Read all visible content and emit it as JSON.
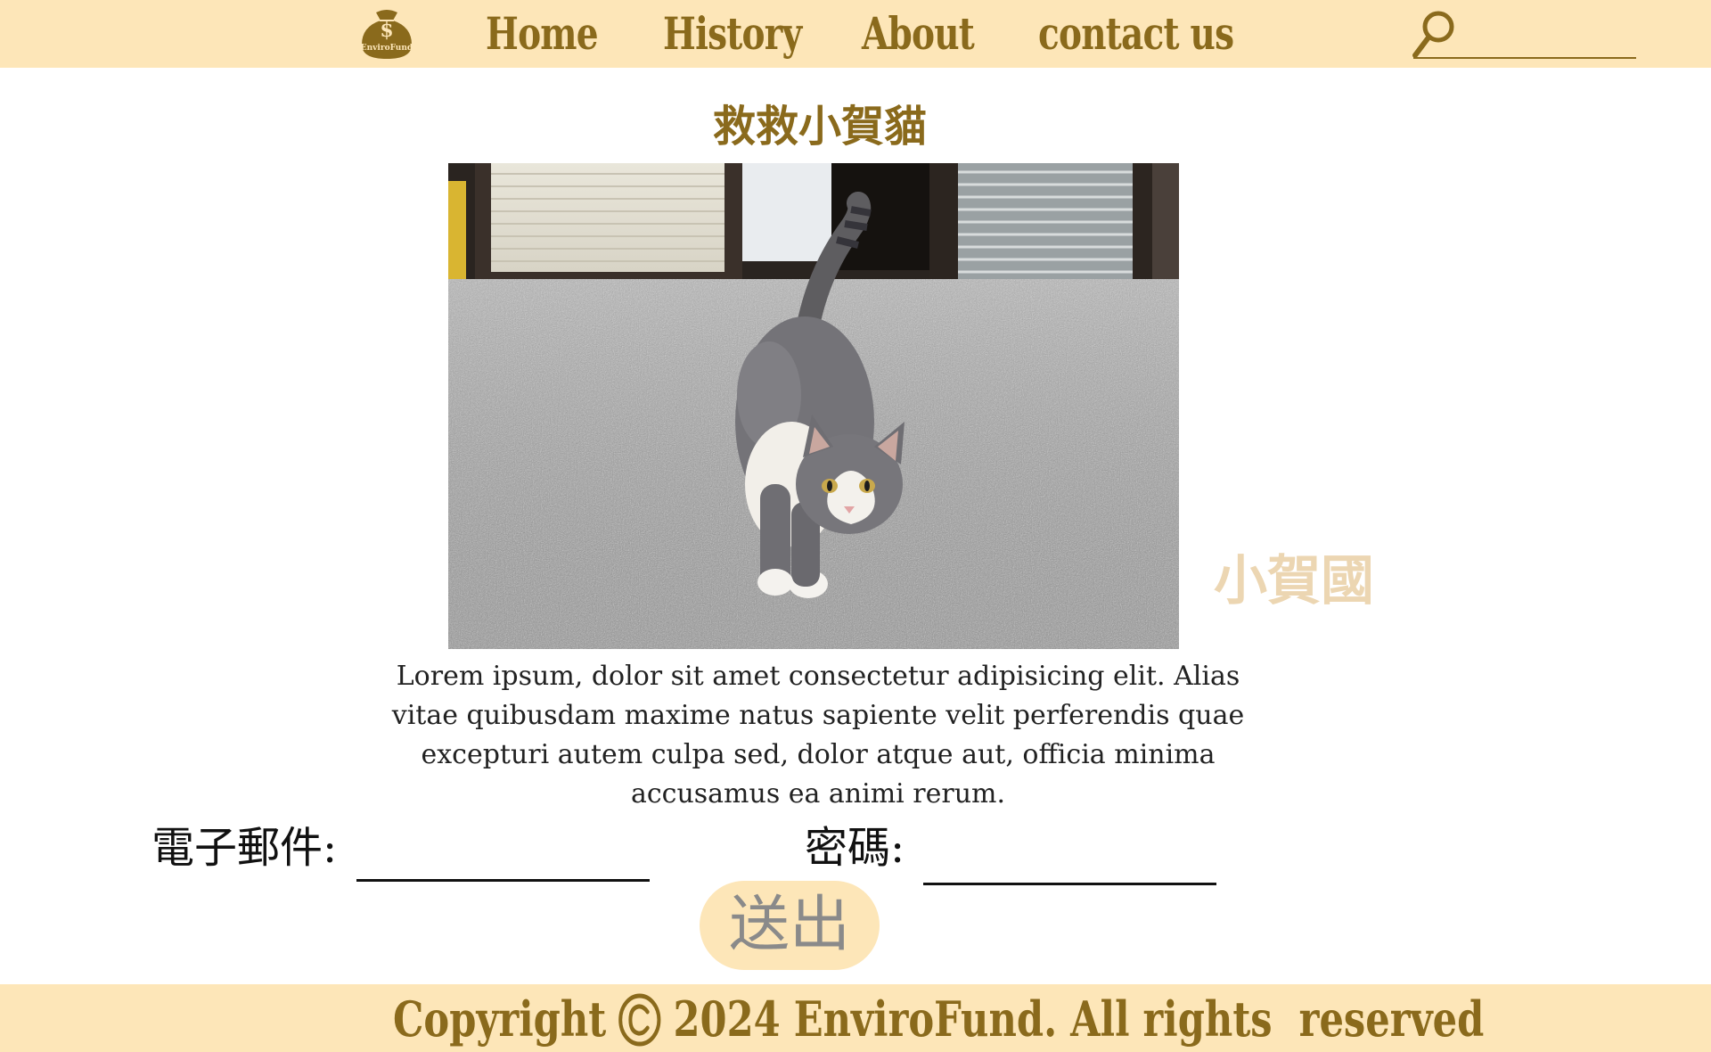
{
  "header": {
    "logo_text": "EnviroFund",
    "logo_symbol": "$",
    "nav": [
      {
        "label": "Home"
      },
      {
        "label": "History"
      },
      {
        "label": "About"
      },
      {
        "label": "contact us"
      }
    ],
    "search": {
      "icon": "search-icon",
      "value": ""
    }
  },
  "main": {
    "title": "救救小賀貓",
    "photo": {
      "subject": "cat-photo"
    },
    "side_label": "小賀國",
    "body_text": "Lorem ipsum, dolor sit amet consectetur adipisicing elit. Alias vitae quibusdam maxime natus sapiente velit perferendis quae excepturi autem culpa sed, dolor atque aut, officia minima accusamus ea animi rerum.",
    "form": {
      "email_label": "電子郵件:",
      "email_value": "",
      "password_label": "密碼:",
      "password_value": "",
      "submit_label": "送出"
    }
  },
  "footer": {
    "copyright_word": "Copyright",
    "copyright_text": "2024 EnviroFund. All rights  reserved"
  },
  "colors": {
    "bar_background": "#fde6b8",
    "brand_brown": "#8a6a1c",
    "side_label": "#ecd6b2",
    "button_text": "#8a8a8a"
  }
}
